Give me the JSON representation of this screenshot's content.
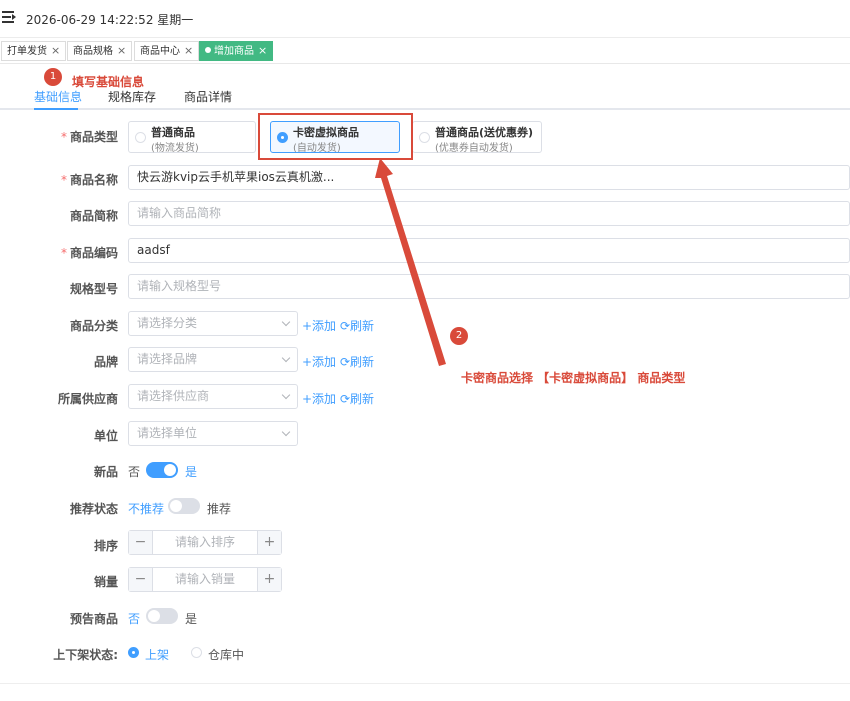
{
  "header": {
    "datetime": "2026-06-29 14:22:52 星期一"
  },
  "tags": [
    {
      "label": "打单发货",
      "close": "×"
    },
    {
      "label": "商品规格",
      "close": "×"
    },
    {
      "label": "商品中心",
      "close": "×"
    },
    {
      "label": "增加商品",
      "close": "×"
    }
  ],
  "subtabs": [
    "基础信息",
    "规格库存",
    "商品详情"
  ],
  "annotations": {
    "step1_num": "1",
    "step1_text": "填写基础信息",
    "step2_num": "2",
    "step2_text": "卡密商品选择 【卡密虚拟商品】 商品类型",
    "color": "#d94a3a"
  },
  "form": {
    "type": {
      "label": "商品类型",
      "options": [
        {
          "title": "普通商品",
          "sub": "(物流发货)"
        },
        {
          "title": "卡密虚拟商品",
          "sub": "(自动发货)"
        },
        {
          "title": "普通商品(送优惠券)",
          "sub": "(优惠券自动发货)"
        }
      ]
    },
    "name": {
      "label": "商品名称",
      "value": "快云游kvip云手机苹果ios云真机激..."
    },
    "short_name": {
      "label": "商品简称",
      "placeholder": "请输入商品简称"
    },
    "code": {
      "label": "商品编码",
      "value": "aadsf"
    },
    "model": {
      "label": "规格型号",
      "placeholder": "请输入规格型号"
    },
    "category": {
      "label": "商品分类",
      "placeholder": "请选择分类"
    },
    "brand": {
      "label": "品牌",
      "placeholder": "请选择品牌"
    },
    "supplier": {
      "label": "所属供应商",
      "placeholder": "请选择供应商"
    },
    "unit": {
      "label": "单位",
      "placeholder": "请选择单位"
    },
    "add_link": "+添加",
    "refresh_link": "⟳刷新",
    "is_new": {
      "label": "新品",
      "off": "否",
      "on": "是"
    },
    "recommend": {
      "label": "推荐状态",
      "off": "不推荐",
      "on": "推荐"
    },
    "sort": {
      "label": "排序",
      "placeholder": "请输入排序",
      "minus": "−",
      "plus": "+"
    },
    "sales": {
      "label": "销量",
      "placeholder": "请输入销量",
      "minus": "−",
      "plus": "+"
    },
    "presale": {
      "label": "预告商品",
      "off": "否",
      "on": "是"
    },
    "shelf": {
      "label": "上下架状态:",
      "on": "上架",
      "off": "仓库中"
    }
  },
  "colors": {
    "primary": "#409eff",
    "tag_active": "#42b983",
    "required": "#f56c6c"
  }
}
